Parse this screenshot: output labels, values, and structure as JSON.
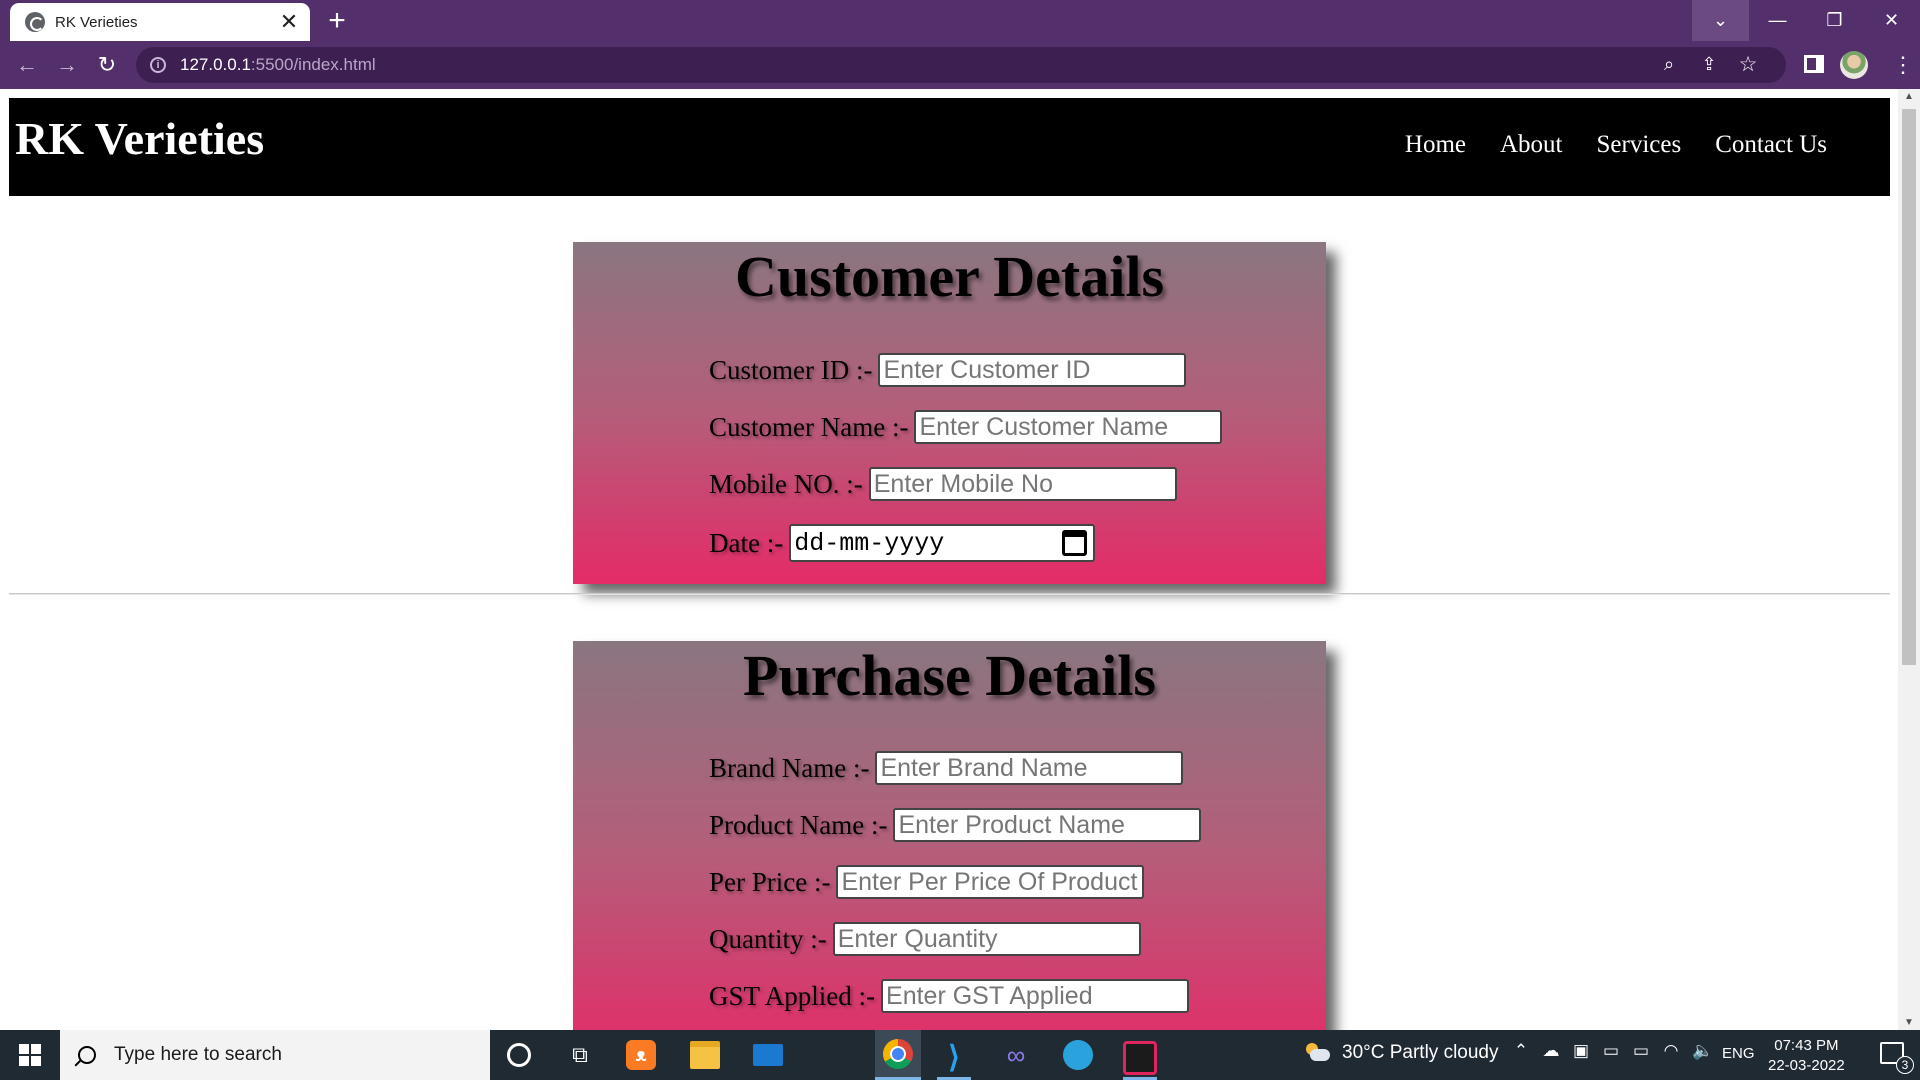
{
  "browser": {
    "tab_title": "RK Verieties",
    "tab_close": "✕",
    "new_tab": "+",
    "url_host": "127.0.0.1",
    "url_path": ":5500/index.html",
    "window_controls": {
      "dropdown": "⌄",
      "minimize": "—",
      "restore": "❐",
      "close": "✕"
    },
    "nav": {
      "back": "←",
      "forward": "→",
      "reload": "↻",
      "info": "i",
      "zoom": "⌕",
      "share": "⇪",
      "star": "☆",
      "menu": "⋮"
    }
  },
  "site": {
    "logo": "RK Verieties",
    "nav_links": [
      "Home",
      "About",
      "Services",
      "Contact Us"
    ]
  },
  "customer_form": {
    "title": "Customer Details",
    "fields": [
      {
        "label": "Customer ID :-",
        "placeholder": "Enter Customer ID"
      },
      {
        "label": "Customer Name :-",
        "placeholder": "Enter Customer Name"
      },
      {
        "label": "Mobile NO. :-",
        "placeholder": "Enter Mobile No"
      }
    ],
    "date": {
      "label": "Date :-",
      "value": "dd-mm-yyyy"
    }
  },
  "purchase_form": {
    "title": "Purchase Details",
    "fields": [
      {
        "label": "Brand Name :-",
        "placeholder": "Enter Brand Name"
      },
      {
        "label": "Product Name :-",
        "placeholder": "Enter Product Name"
      },
      {
        "label": "Per Price :-",
        "placeholder": "Enter Per Price Of Product"
      },
      {
        "label": "Quantity :-",
        "placeholder": "Enter Quantity"
      },
      {
        "label": "GST Applied :-",
        "placeholder": "Enter GST Applied"
      }
    ]
  },
  "taskbar": {
    "search_placeholder": "Type here to search",
    "taskview": "⧉",
    "xampp": "ᴥ",
    "vscode": "⟩",
    "infinity": "∞",
    "weather": "30°C  Partly cloudy",
    "tray": {
      "chevron": "⌃",
      "onedrive": "☁",
      "meet": "▣",
      "display": "▭",
      "battery": "▭",
      "wifi": "◠",
      "volume": "🔈"
    },
    "language": "ENG",
    "time": "07:43 PM",
    "date": "22-03-2022",
    "notification_count": "3"
  },
  "colors": {
    "chrome_frame": "#532f6b",
    "header_bg": "#000000",
    "card_gradient_top": "#8a7680",
    "card_gradient_bottom": "#e42b68"
  }
}
